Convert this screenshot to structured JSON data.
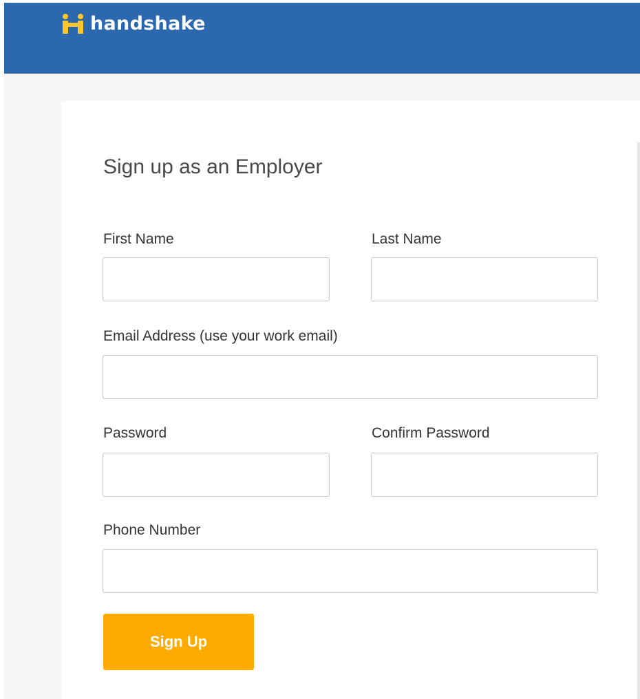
{
  "header": {
    "logo_text": "handshake",
    "logo_icon": "handshake-logo-icon",
    "background_color": "#2b68ad",
    "logo_accent_color": "#ffc72c"
  },
  "form": {
    "title": "Sign up as an Employer",
    "first_name": {
      "label": "First Name",
      "value": ""
    },
    "last_name": {
      "label": "Last Name",
      "value": ""
    },
    "email": {
      "label": "Email Address (use your work email)",
      "value": ""
    },
    "password": {
      "label": "Password",
      "value": ""
    },
    "confirm_password": {
      "label": "Confirm Password",
      "value": ""
    },
    "phone": {
      "label": "Phone Number",
      "value": ""
    },
    "submit_label": "Sign Up",
    "submit_color": "#fdab00"
  }
}
